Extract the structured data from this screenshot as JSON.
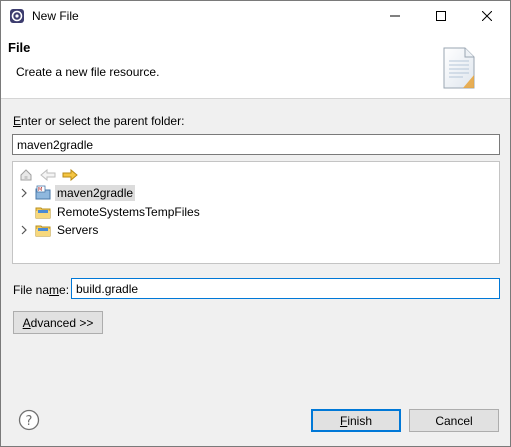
{
  "window": {
    "title": "New File"
  },
  "banner": {
    "title": "File",
    "description": "Create a new file resource."
  },
  "folder": {
    "label_pre": "",
    "label_u": "E",
    "label_post": "nter or select the parent folder:",
    "value": "maven2gradle"
  },
  "tree": {
    "toolbar": [
      "home-icon",
      "back-icon",
      "forward-icon"
    ],
    "items": [
      {
        "label": "maven2gradle",
        "expandable": true,
        "selected": true,
        "icon": "project-icon"
      },
      {
        "label": "RemoteSystemsTempFiles",
        "expandable": false,
        "selected": false,
        "icon": "folder-icon"
      },
      {
        "label": "Servers",
        "expandable": true,
        "selected": false,
        "icon": "folder-icon"
      }
    ]
  },
  "filename": {
    "label_pre": "File na",
    "label_u": "m",
    "label_post": "e:",
    "value": "build.gradle"
  },
  "buttons": {
    "advanced_u": "A",
    "advanced_rest": "dvanced >>",
    "finish_u": "F",
    "finish_rest": "inish",
    "cancel": "Cancel"
  },
  "colors": {
    "accent": "#0078d7",
    "selection": "#dcdcdc"
  }
}
